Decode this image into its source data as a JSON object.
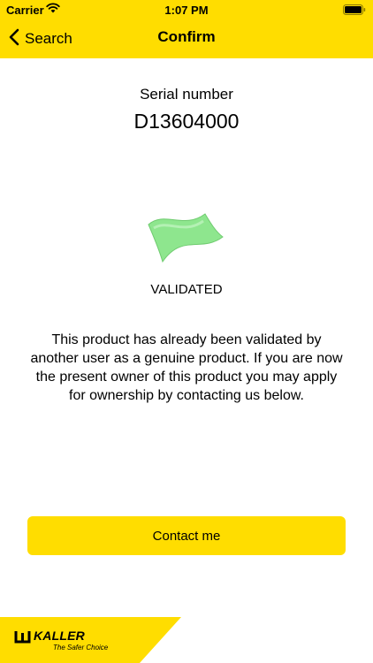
{
  "status_bar": {
    "carrier": "Carrier",
    "time": "1:07 PM",
    "icons": [
      "wifi-icon",
      "battery-icon"
    ]
  },
  "nav": {
    "back_label": "Search",
    "title": "Confirm",
    "icons": [
      "chevron-left-icon"
    ]
  },
  "serial": {
    "label": "Serial number",
    "value": "D13604000"
  },
  "validation": {
    "icon": "green-flag-icon",
    "status": "VALIDATED",
    "message": "This product has already been validated by another user as a genuine product. If you are now the present owner of this product you may apply for ownership by contacting us below."
  },
  "actions": {
    "contact_label": "Contact me"
  },
  "brand": {
    "name": "KALLER",
    "tagline": "The Safer Choice"
  },
  "colors": {
    "accent": "#FFDD00",
    "flag": "#8EE68E"
  }
}
